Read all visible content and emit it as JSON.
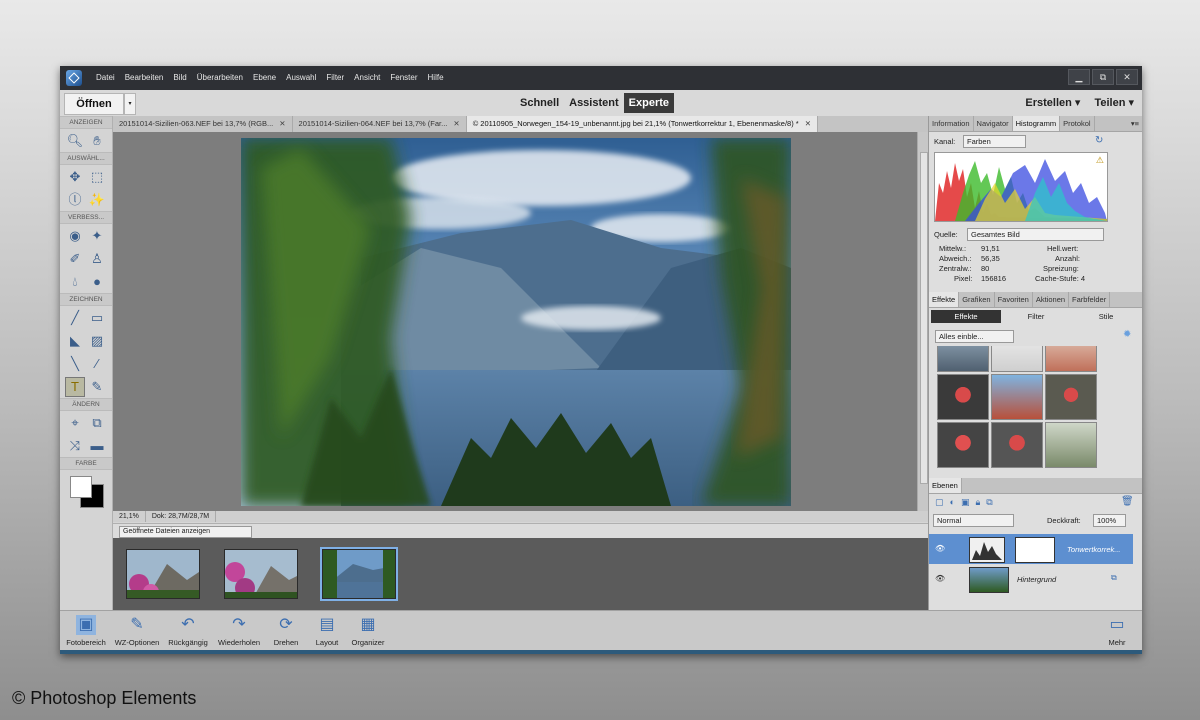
{
  "menu": [
    "Datei",
    "Bearbeiten",
    "Bild",
    "Überarbeiten",
    "Ebene",
    "Auswahl",
    "Filter",
    "Ansicht",
    "Fenster",
    "Hilfe"
  ],
  "window_controls": [
    "▁",
    "⧉",
    "✕"
  ],
  "modebar": {
    "open_label": "Öffnen",
    "open_drop": "▾",
    "modes": [
      "Schnell",
      "Assistent",
      "Experte"
    ],
    "active_mode": "Experte",
    "create_label": "Erstellen ▾",
    "share_label": "Teilen ▾"
  },
  "toolbox": {
    "sections": [
      "ANZEIGEN",
      "AUSWÄHL...",
      "VERBESS...",
      "ZEICHNEN",
      "ÄNDERN",
      "FARBE"
    ]
  },
  "doc_tabs": [
    {
      "label": "20151014-Sizilien-063.NEF bei 13,7% (RGB...",
      "close": "✕",
      "active": false
    },
    {
      "label": "20151014-Sizilien-064.NEF bei 13,7% (Far...",
      "close": "✕",
      "active": false
    },
    {
      "label": "© 20110905_Norwegen_154-19_unbenannt.jpg bei 21,1% (Tonwertkorrektur 1, Ebenenmaske/8) *",
      "close": "✕",
      "active": true
    }
  ],
  "status": {
    "zoom": "21,1%",
    "doc": "Dok: 28,7M/28,7M"
  },
  "photobin": {
    "select": "Geöffnete Dateien anzeigen",
    "thumb_count": 3
  },
  "histogram_panel": {
    "tabs": [
      "Information",
      "Navigator",
      "Histogramm",
      "Protokol"
    ],
    "active_tab": "Histogramm",
    "channel_label": "Kanal:",
    "channel_value": "Farben",
    "source_label": "Quelle:",
    "source_value": "Gesamtes Bild",
    "stats_left": [
      {
        "label": "Mittelw.:",
        "value": "91,51"
      },
      {
        "label": "Abweich.:",
        "value": "56,35"
      },
      {
        "label": "Zentralw.:",
        "value": "80"
      },
      {
        "label": "Pixel:",
        "value": "156816"
      }
    ],
    "stats_right": [
      "Hell.wert:",
      "Anzahl:",
      "Spreizung:",
      "Cache-Stufe: 4"
    ]
  },
  "effects_panel": {
    "tabs": [
      "Effekte",
      "Grafiken",
      "Favoriten",
      "Aktionen",
      "Farbfelder"
    ],
    "active_tab": "Effekte",
    "subtabs": [
      "Effekte",
      "Filter",
      "Stile"
    ],
    "active_subtab": "Effekte",
    "dropdown": "Alles einble..."
  },
  "layers_panel": {
    "tab": "Ebenen",
    "blend_mode": "Normal",
    "opacity_label": "Deckkraft:",
    "opacity_value": "100%",
    "layers": [
      {
        "name": "Tonwertkorrek...",
        "selected": true
      },
      {
        "name": "Hintergrund",
        "selected": false
      }
    ]
  },
  "taskbar": [
    "Fotobereich",
    "WZ-Optionen",
    "Rückgängig",
    "Wiederholen",
    "Drehen",
    "Layout",
    "Organizer"
  ],
  "taskbar_more": "Mehr",
  "credit": "© Photoshop Elements",
  "colors": {
    "accent": "#5d8fd0",
    "titlebar": "#2e3035",
    "canvas": "#7d7d7d"
  }
}
